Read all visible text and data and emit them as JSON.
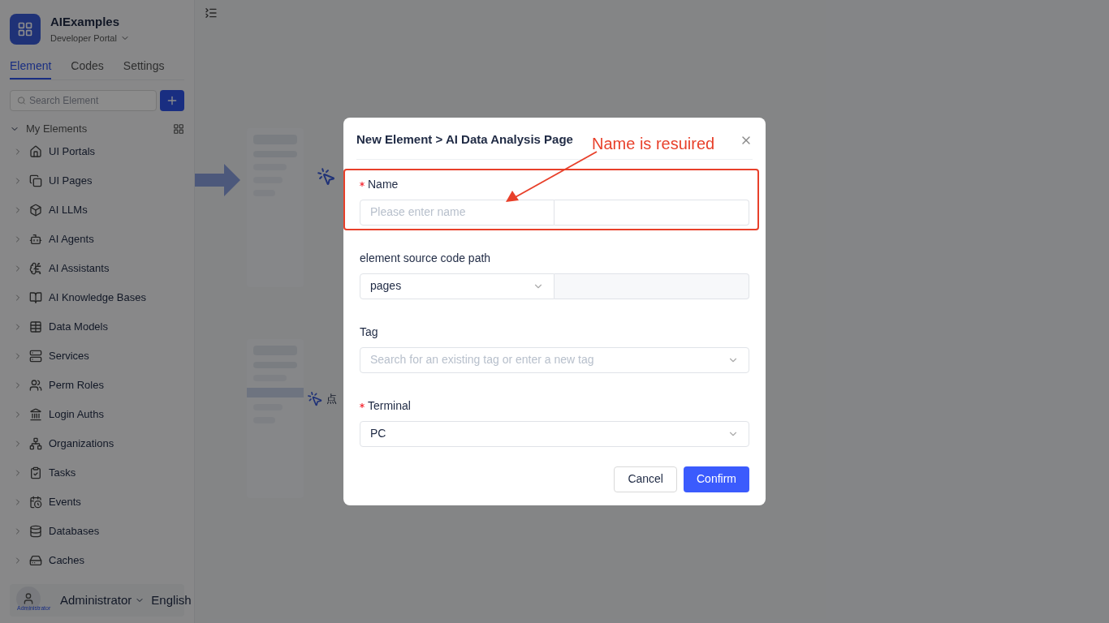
{
  "app": {
    "name": "AIExamples",
    "portal": "Developer Portal"
  },
  "tabs": [
    {
      "label": "Element",
      "selected": true
    },
    {
      "label": "Codes",
      "selected": false
    },
    {
      "label": "Settings",
      "selected": false
    }
  ],
  "search": {
    "placeholder": "Search Element"
  },
  "tree": {
    "label": "My Elements",
    "expanded": true,
    "children": [
      {
        "label": "UI Portals",
        "expanded": false
      },
      {
        "label": "UI Pages",
        "expanded": false
      },
      {
        "label": "AI LLMs",
        "expanded": false
      },
      {
        "label": "AI Agents",
        "expanded": false
      },
      {
        "label": "AI Assistants",
        "expanded": false
      },
      {
        "label": "AI Knowledge Bases",
        "expanded": false
      },
      {
        "label": "Data Models",
        "expanded": false
      },
      {
        "label": "Services",
        "expanded": false
      },
      {
        "label": "Perm Roles",
        "expanded": false
      },
      {
        "label": "Login Auths",
        "expanded": false
      },
      {
        "label": "Organizations",
        "expanded": false
      },
      {
        "label": "Tasks",
        "expanded": false
      },
      {
        "label": "Events",
        "expanded": false
      },
      {
        "label": "Databases",
        "expanded": false
      },
      {
        "label": "Caches",
        "expanded": false
      }
    ]
  },
  "user": {
    "avatar_label": "Administrator",
    "name": "Administrator",
    "language": "English"
  },
  "background": {
    "hint_char": "点"
  },
  "dialog": {
    "title": "New Element > AI Data Analysis Page",
    "fields": [
      {
        "kind": "split-input",
        "label": "Name",
        "required": true,
        "placeholder": "Please enter name"
      },
      {
        "kind": "select-path",
        "label": "element source code path",
        "required": false,
        "value": "pages"
      },
      {
        "kind": "select",
        "label": "Tag",
        "required": false,
        "placeholder": "Search for an existing tag or enter a new tag"
      },
      {
        "kind": "select",
        "label": "Terminal",
        "required": true,
        "value": "PC"
      }
    ],
    "buttons": [
      {
        "label": "Cancel",
        "kind": "secondary"
      },
      {
        "label": "Confirm",
        "kind": "primary"
      }
    ]
  },
  "annotation": {
    "text": "Name is resuired"
  }
}
